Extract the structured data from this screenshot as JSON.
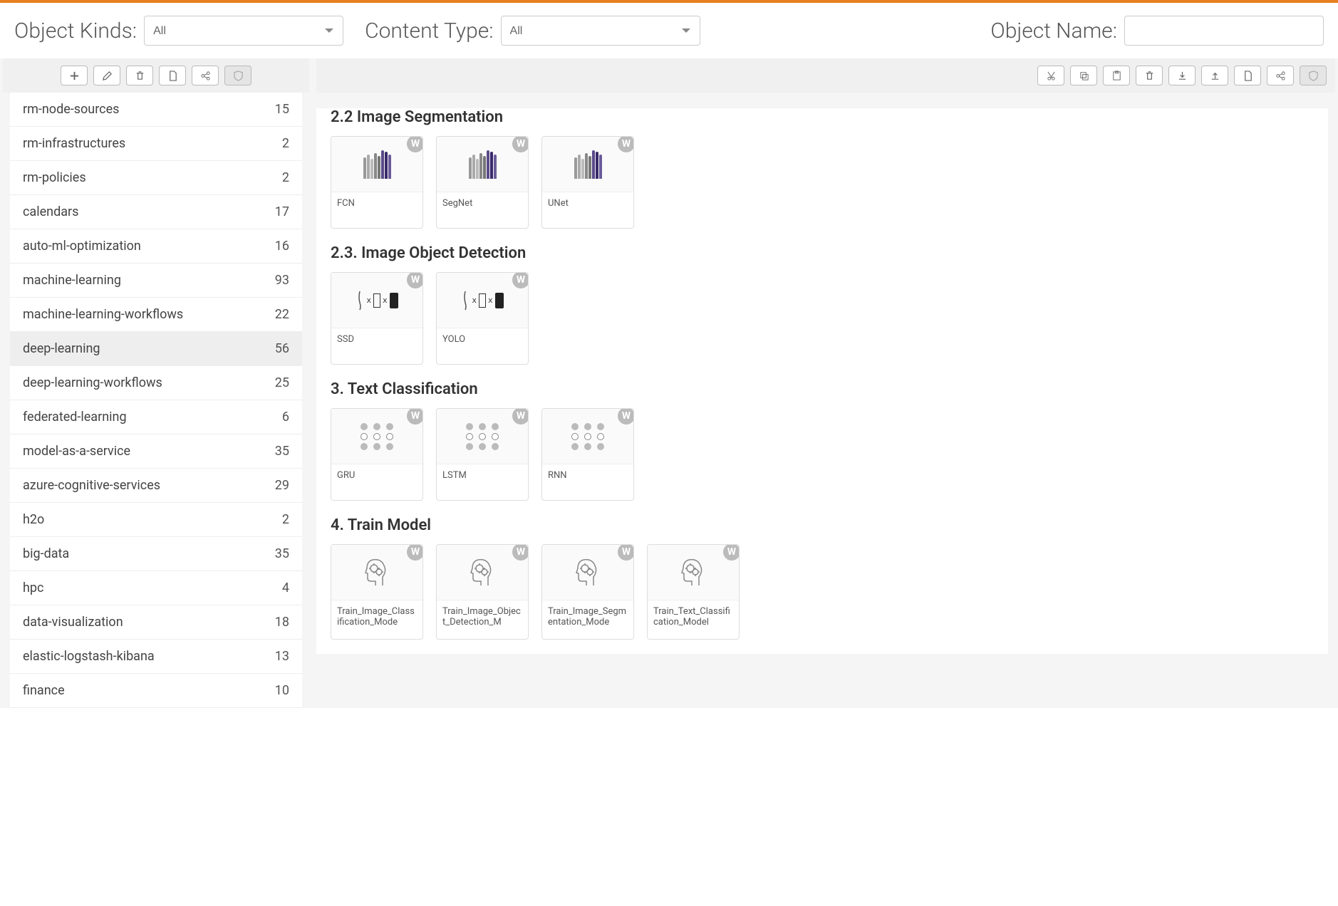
{
  "filters": {
    "objectKindsLabel": "Object Kinds:",
    "objectKindsValue": "All",
    "contentTypeLabel": "Content Type:",
    "contentTypeValue": "All",
    "objectNameLabel": "Object Name:",
    "objectNameValue": ""
  },
  "sidebar": {
    "items": [
      {
        "name": "rm-node-sources",
        "count": 15,
        "active": false
      },
      {
        "name": "rm-infrastructures",
        "count": 2,
        "active": false
      },
      {
        "name": "rm-policies",
        "count": 2,
        "active": false
      },
      {
        "name": "calendars",
        "count": 17,
        "active": false
      },
      {
        "name": "auto-ml-optimization",
        "count": 16,
        "active": false
      },
      {
        "name": "machine-learning",
        "count": 93,
        "active": false
      },
      {
        "name": "machine-learning-workflows",
        "count": 22,
        "active": false
      },
      {
        "name": "deep-learning",
        "count": 56,
        "active": true
      },
      {
        "name": "deep-learning-workflows",
        "count": 25,
        "active": false
      },
      {
        "name": "federated-learning",
        "count": 6,
        "active": false
      },
      {
        "name": "model-as-a-service",
        "count": 35,
        "active": false
      },
      {
        "name": "azure-cognitive-services",
        "count": 29,
        "active": false
      },
      {
        "name": "h2o",
        "count": 2,
        "active": false
      },
      {
        "name": "big-data",
        "count": 35,
        "active": false
      },
      {
        "name": "hpc",
        "count": 4,
        "active": false
      },
      {
        "name": "data-visualization",
        "count": 18,
        "active": false
      },
      {
        "name": "elastic-logstash-kibana",
        "count": 13,
        "active": false
      },
      {
        "name": "finance",
        "count": 10,
        "active": false
      }
    ]
  },
  "sections": [
    {
      "title": "2.2 Image Segmentation",
      "type": "seg",
      "cards": [
        {
          "label": "FCN"
        },
        {
          "label": "SegNet"
        },
        {
          "label": "UNet"
        }
      ]
    },
    {
      "title": "2.3. Image Object Detection",
      "type": "det",
      "cards": [
        {
          "label": "SSD"
        },
        {
          "label": "YOLO"
        }
      ]
    },
    {
      "title": "3. Text Classification",
      "type": "rnn",
      "cards": [
        {
          "label": "GRU"
        },
        {
          "label": "LSTM"
        },
        {
          "label": "RNN"
        }
      ]
    },
    {
      "title": "4. Train Model",
      "type": "head",
      "cards": [
        {
          "label": "Train_Image_Classification_Mode"
        },
        {
          "label": "Train_Image_Object_Detection_M"
        },
        {
          "label": "Train_Image_Segmentation_Mode"
        },
        {
          "label": "Train_Text_Classification_Model"
        }
      ]
    }
  ],
  "badge": "W"
}
